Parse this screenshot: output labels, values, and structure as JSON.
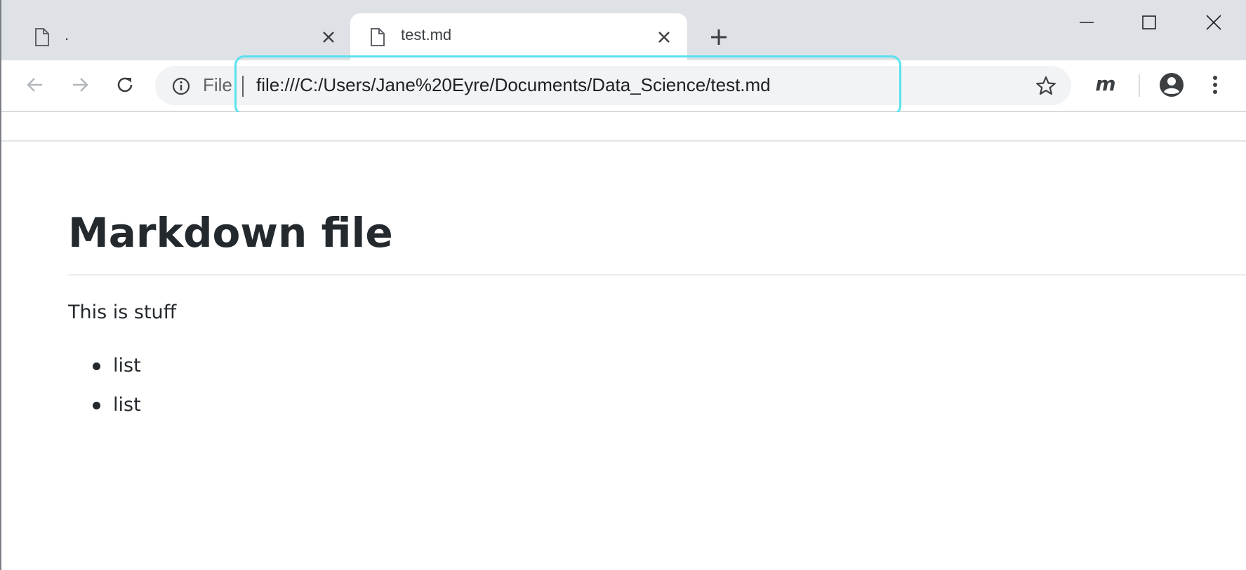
{
  "tabs": [
    {
      "title": ".",
      "active": false,
      "icon": "document-icon"
    },
    {
      "title": "test.md",
      "active": true,
      "icon": "document-icon"
    }
  ],
  "toolbar": {
    "omnibox": {
      "chip_label": "File",
      "url": "file:///C:/Users/Jane%20Eyre/Documents/Data_Science/test.md"
    },
    "extension_label": "m"
  },
  "page": {
    "heading": "Markdown file",
    "paragraph": "This is stuff",
    "list_items": [
      "list",
      "list"
    ]
  },
  "colors": {
    "tabstrip_bg": "#dee1e6",
    "omnibox_bg": "#f1f3f4",
    "highlight": "#59e2ee",
    "text": "#24292e"
  }
}
